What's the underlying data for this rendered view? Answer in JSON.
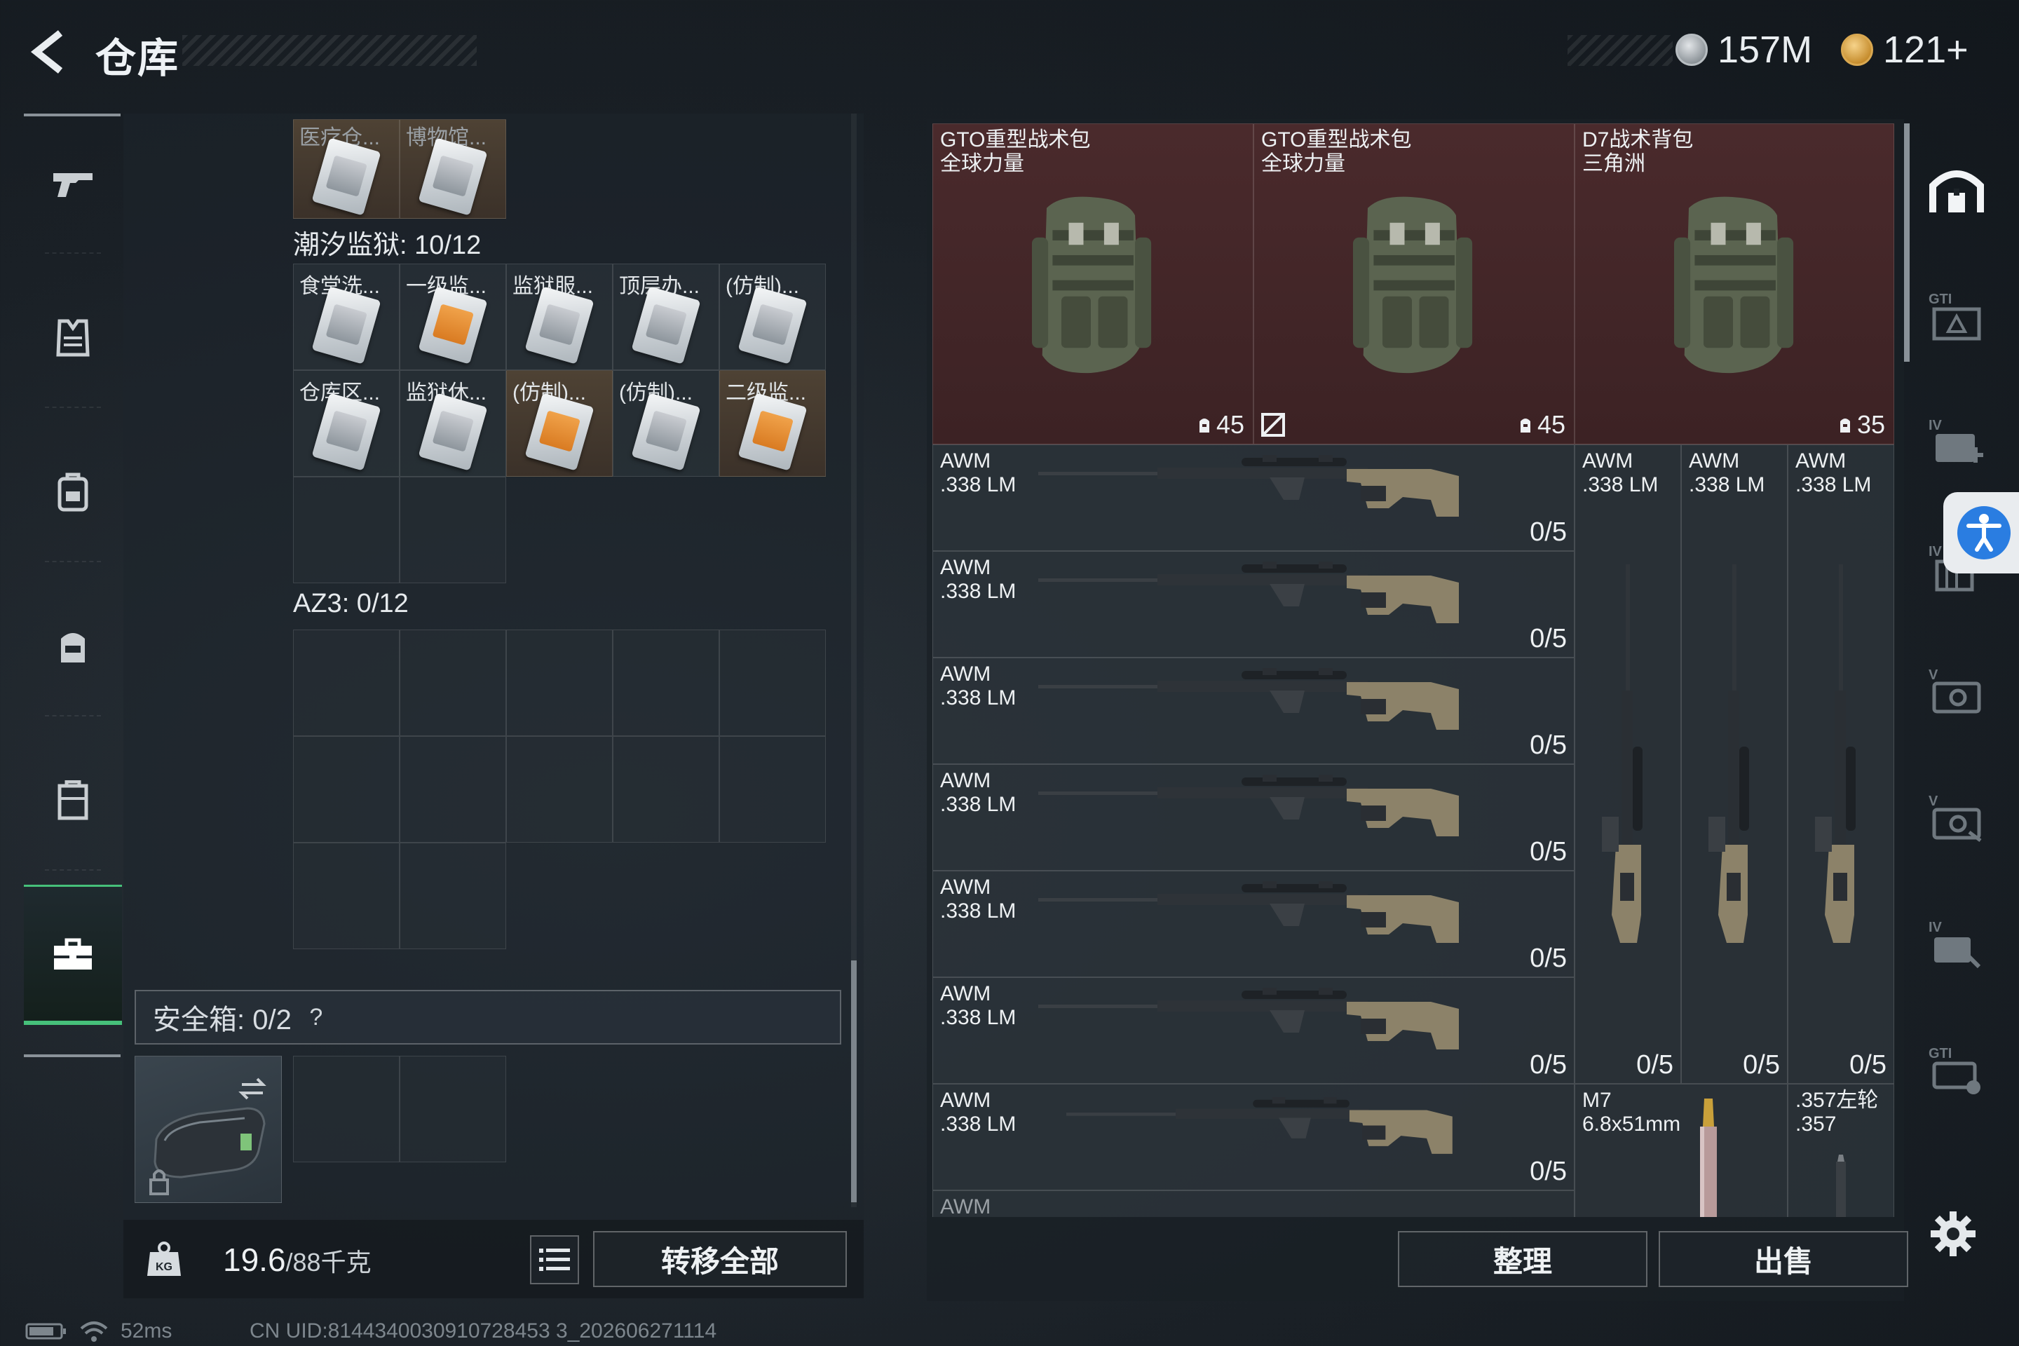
{
  "header": {
    "title": "仓库",
    "currency": [
      {
        "icon": "silver-coin-icon",
        "value": "157M"
      },
      {
        "icon": "gold-triangle-coin-icon",
        "value": "121+"
      }
    ]
  },
  "nav": [
    "gun-icon",
    "armor-vest-icon",
    "backpack-icon",
    "chest-rig-icon",
    "case-icon",
    "toolbox-icon"
  ],
  "container": {
    "top_items": [
      "医疗仓...",
      "博物馆..."
    ],
    "tide_prison": {
      "label": "潮汐监狱: 10/12",
      "items": [
        "食堂洗...",
        "一级监...",
        "监狱服...",
        "顶层办...",
        "(仿制)...",
        "仓库区...",
        "监狱休...",
        "(仿制)...",
        "(仿制)...",
        "二级监..."
      ]
    },
    "az3": {
      "label": "AZ3: 0/12"
    },
    "safe_box": {
      "label": "安全箱: 0/2",
      "help": "?"
    }
  },
  "bottom": {
    "weight_value": "19.6",
    "weight_max": "/88千克",
    "weight_badge": "KG",
    "transfer_all": "转移全部"
  },
  "stash": {
    "backpacks": [
      {
        "name": "GTO重型战术包\n全球力量",
        "capacity": "45",
        "locked": false
      },
      {
        "name": "GTO重型战术包\n全球力量",
        "capacity": "45",
        "locked": true
      },
      {
        "name": "D7战术背包\n三角洲",
        "capacity": "35",
        "locked": false
      }
    ],
    "rifles_horizontal": [
      {
        "name": "AWM\n.338 LM",
        "count": "0/5"
      },
      {
        "name": "AWM\n.338 LM",
        "count": "0/5"
      },
      {
        "name": "AWM\n.338 LM",
        "count": "0/5"
      },
      {
        "name": "AWM\n.338 LM",
        "count": "0/5"
      },
      {
        "name": "AWM\n.338 LM",
        "count": "0/5"
      },
      {
        "name": "AWM\n.338 LM",
        "count": "0/5"
      },
      {
        "name": "AWM\n.338 LM",
        "count": "0/5"
      }
    ],
    "rifles_vertical": [
      {
        "name": "AWM\n.338 LM",
        "count": "0/5"
      },
      {
        "name": "AWM\n.338 LM",
        "count": "0/5"
      },
      {
        "name": "AWM\n.338 LM",
        "count": "0/5"
      }
    ],
    "ammo": [
      {
        "name": "M7\n6.8x51mm"
      },
      {
        "name": ".357左轮\n.357"
      }
    ],
    "partial_last": "AWM",
    "sort_label": "整理",
    "sell_label": "出售"
  },
  "side_tabs": [
    "home-base-icon",
    "gti-tab-icon",
    "iv-plus-tab-icon",
    "iv-tab-icon",
    "v-tab-icon-1",
    "v-tab-icon-2",
    "iv-tab-icon-2",
    "gti-tab-icon-2"
  ],
  "status": {
    "ping": "52ms",
    "uid": "CN UID:8144340030910728453 3_202606271114"
  },
  "colors": {
    "accent_green": "#46c07a",
    "backpack_bg": "#4a2a2c"
  }
}
